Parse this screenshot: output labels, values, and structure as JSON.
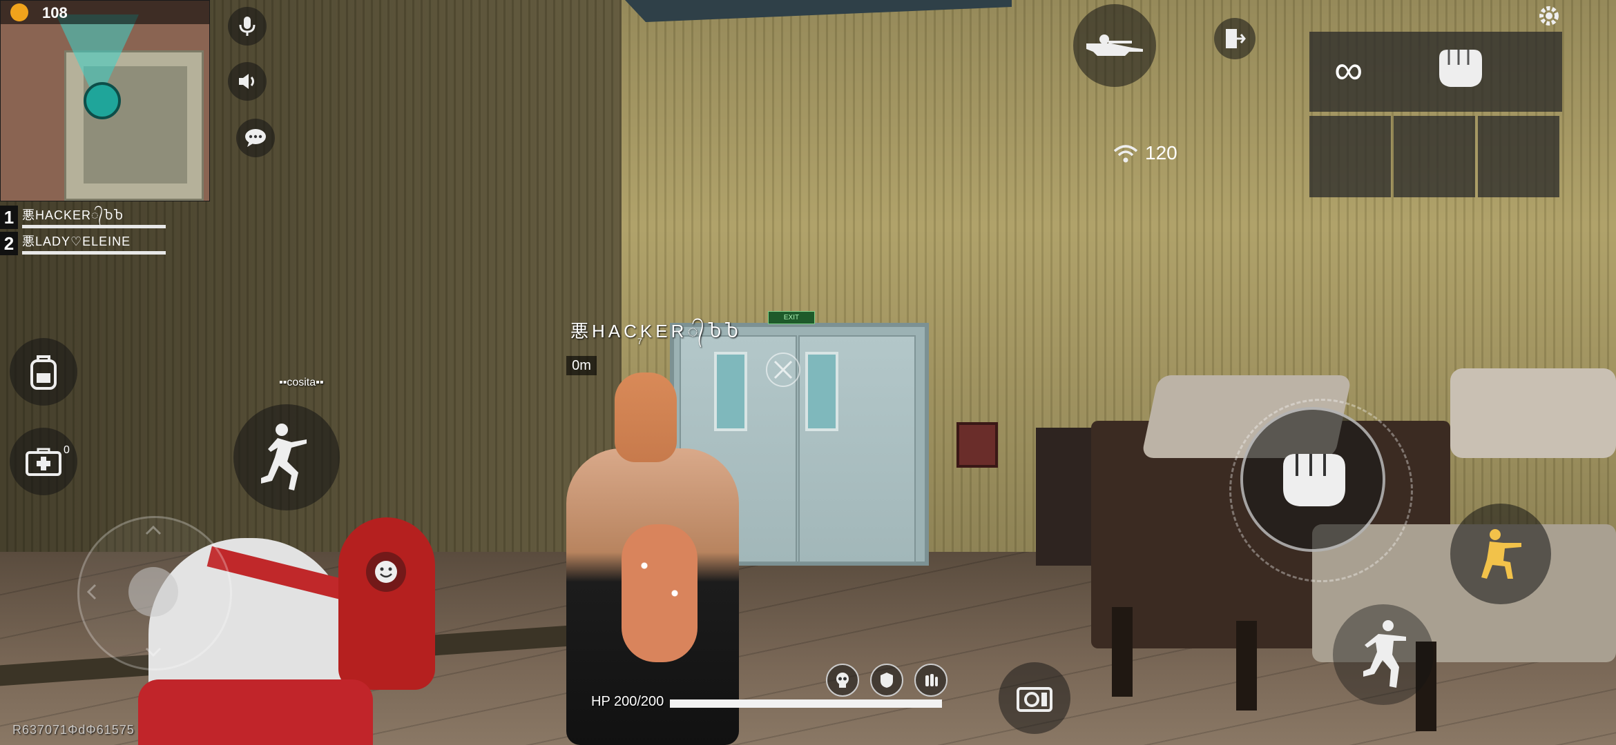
{
  "hud": {
    "coins": "108",
    "team": [
      {
        "num": "1",
        "name": "悪HACKER᭄ႦႦ"
      },
      {
        "num": "2",
        "name": "悪LADY♡ELEINE"
      }
    ],
    "ping": "120",
    "player_tag": "悪HACKER᭄ႦႦ",
    "player_sub": "7",
    "distance": "0m",
    "npc_name": "▪▪cosita▪▪",
    "medkit_count": "0",
    "hp_label": "HP 200/200",
    "hp_fraction": 1.0,
    "ammo": "∞",
    "player_id": "R637071ΦdΦ61575",
    "exit_sign": "EXIT"
  },
  "icons": {
    "mic": "microphone-icon",
    "speaker": "speaker-icon",
    "chat": "chat-bubble-icon",
    "backpack": "backpack-icon",
    "medkit": "medkit-icon",
    "run": "sprint-icon",
    "prone": "prone-icon",
    "exit": "exit-door-icon",
    "settings": "gear-icon",
    "wifi": "wifi-icon",
    "fist": "fist-icon",
    "crouch": "crouch-icon",
    "jump": "jump-icon",
    "emote": "smiley-icon",
    "camera": "camera-icon"
  },
  "colors": {
    "coin": "#f0a31c",
    "crouch_accent": "#f2c24a",
    "minimap_marker": "#1fa59a"
  }
}
